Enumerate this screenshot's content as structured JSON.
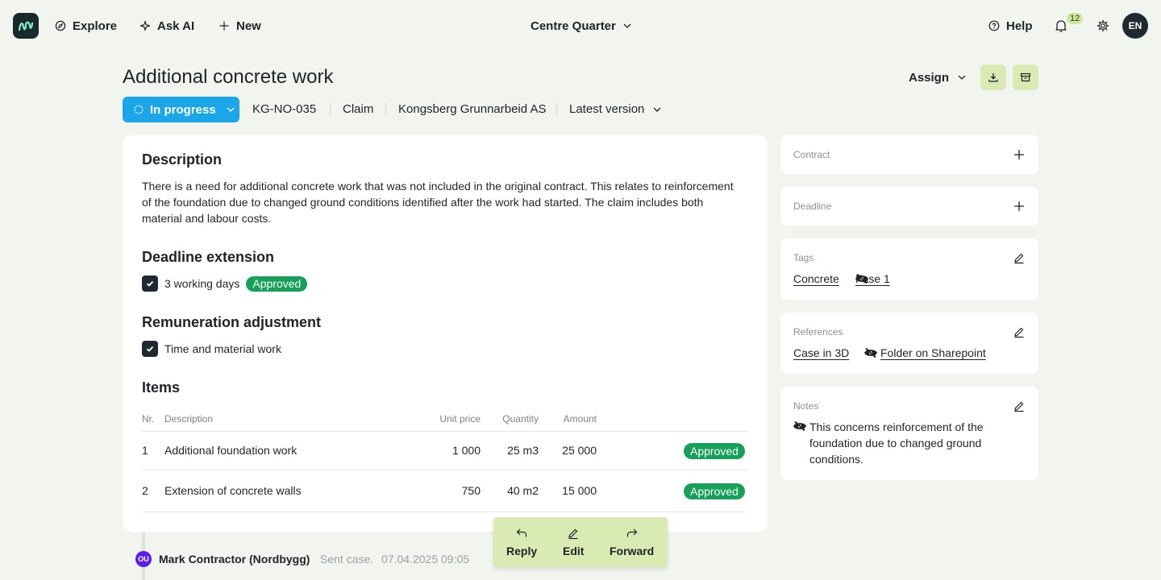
{
  "nav": {
    "logo_icon": "brand-logo-icon",
    "explore": "Explore",
    "ask_ai": "Ask AI",
    "new": "New",
    "project": "Centre Quarter",
    "help": "Help",
    "notifications_count": "12",
    "avatar_initials": "EN"
  },
  "header": {
    "title": "Additional concrete work",
    "assign": "Assign"
  },
  "meta": {
    "status": "In progress",
    "id": "KG-NO-035",
    "type": "Claim",
    "company": "Kongsberg Grunnarbeid AS",
    "version": "Latest version"
  },
  "main": {
    "description_heading": "Description",
    "description": "There is a need for additional concrete work that was not included in the original contract. This relates to reinforcement of the foundation due to changed ground conditions identified after the work had started. The claim includes both material and labour costs.",
    "deadline_heading": "Deadline extension",
    "deadline_value": "3 working days",
    "deadline_status": "Approved",
    "remuneration_heading": "Remuneration adjustment",
    "remuneration_value": "Time and material work",
    "items_heading": "Items",
    "columns": {
      "nr": "Nr.",
      "description": "Description",
      "unit_price": "Unit price",
      "quantity": "Quantity",
      "amount": "Amount"
    },
    "items": [
      {
        "nr": "1",
        "description": "Additional foundation work",
        "unit_price": "1 000",
        "quantity": "25 m3",
        "amount": "25 000",
        "status": "Approved"
      },
      {
        "nr": "2",
        "description": "Extension of concrete walls",
        "unit_price": "750",
        "quantity": "40 m2",
        "amount": "15 000",
        "status": "Approved"
      }
    ]
  },
  "sidebar": {
    "contract_label": "Contract",
    "deadline_label": "Deadline",
    "tags_label": "Tags",
    "tags": [
      "Concrete",
      "Fase 1"
    ],
    "references_label": "References",
    "references": [
      "Case in 3D",
      "Folder on Sharepoint"
    ],
    "notes_label": "Notes",
    "notes": "This concerns reinforcement of the foundation due to changed ground conditions."
  },
  "activity": {
    "avatar_initials": "OU",
    "author": "Mark Contractor (Nordbygg)",
    "action": "Sent case.",
    "timestamp": "07.04.2025 09:05"
  },
  "actions": {
    "reply": "Reply",
    "edit": "Edit",
    "forward": "Forward"
  },
  "colors": {
    "background": "#f2f5ef",
    "status_blue": "#1aa6e8",
    "approved_green": "#16a05a",
    "accent_lime": "#d9ebb3",
    "dark": "#1f2a30"
  }
}
